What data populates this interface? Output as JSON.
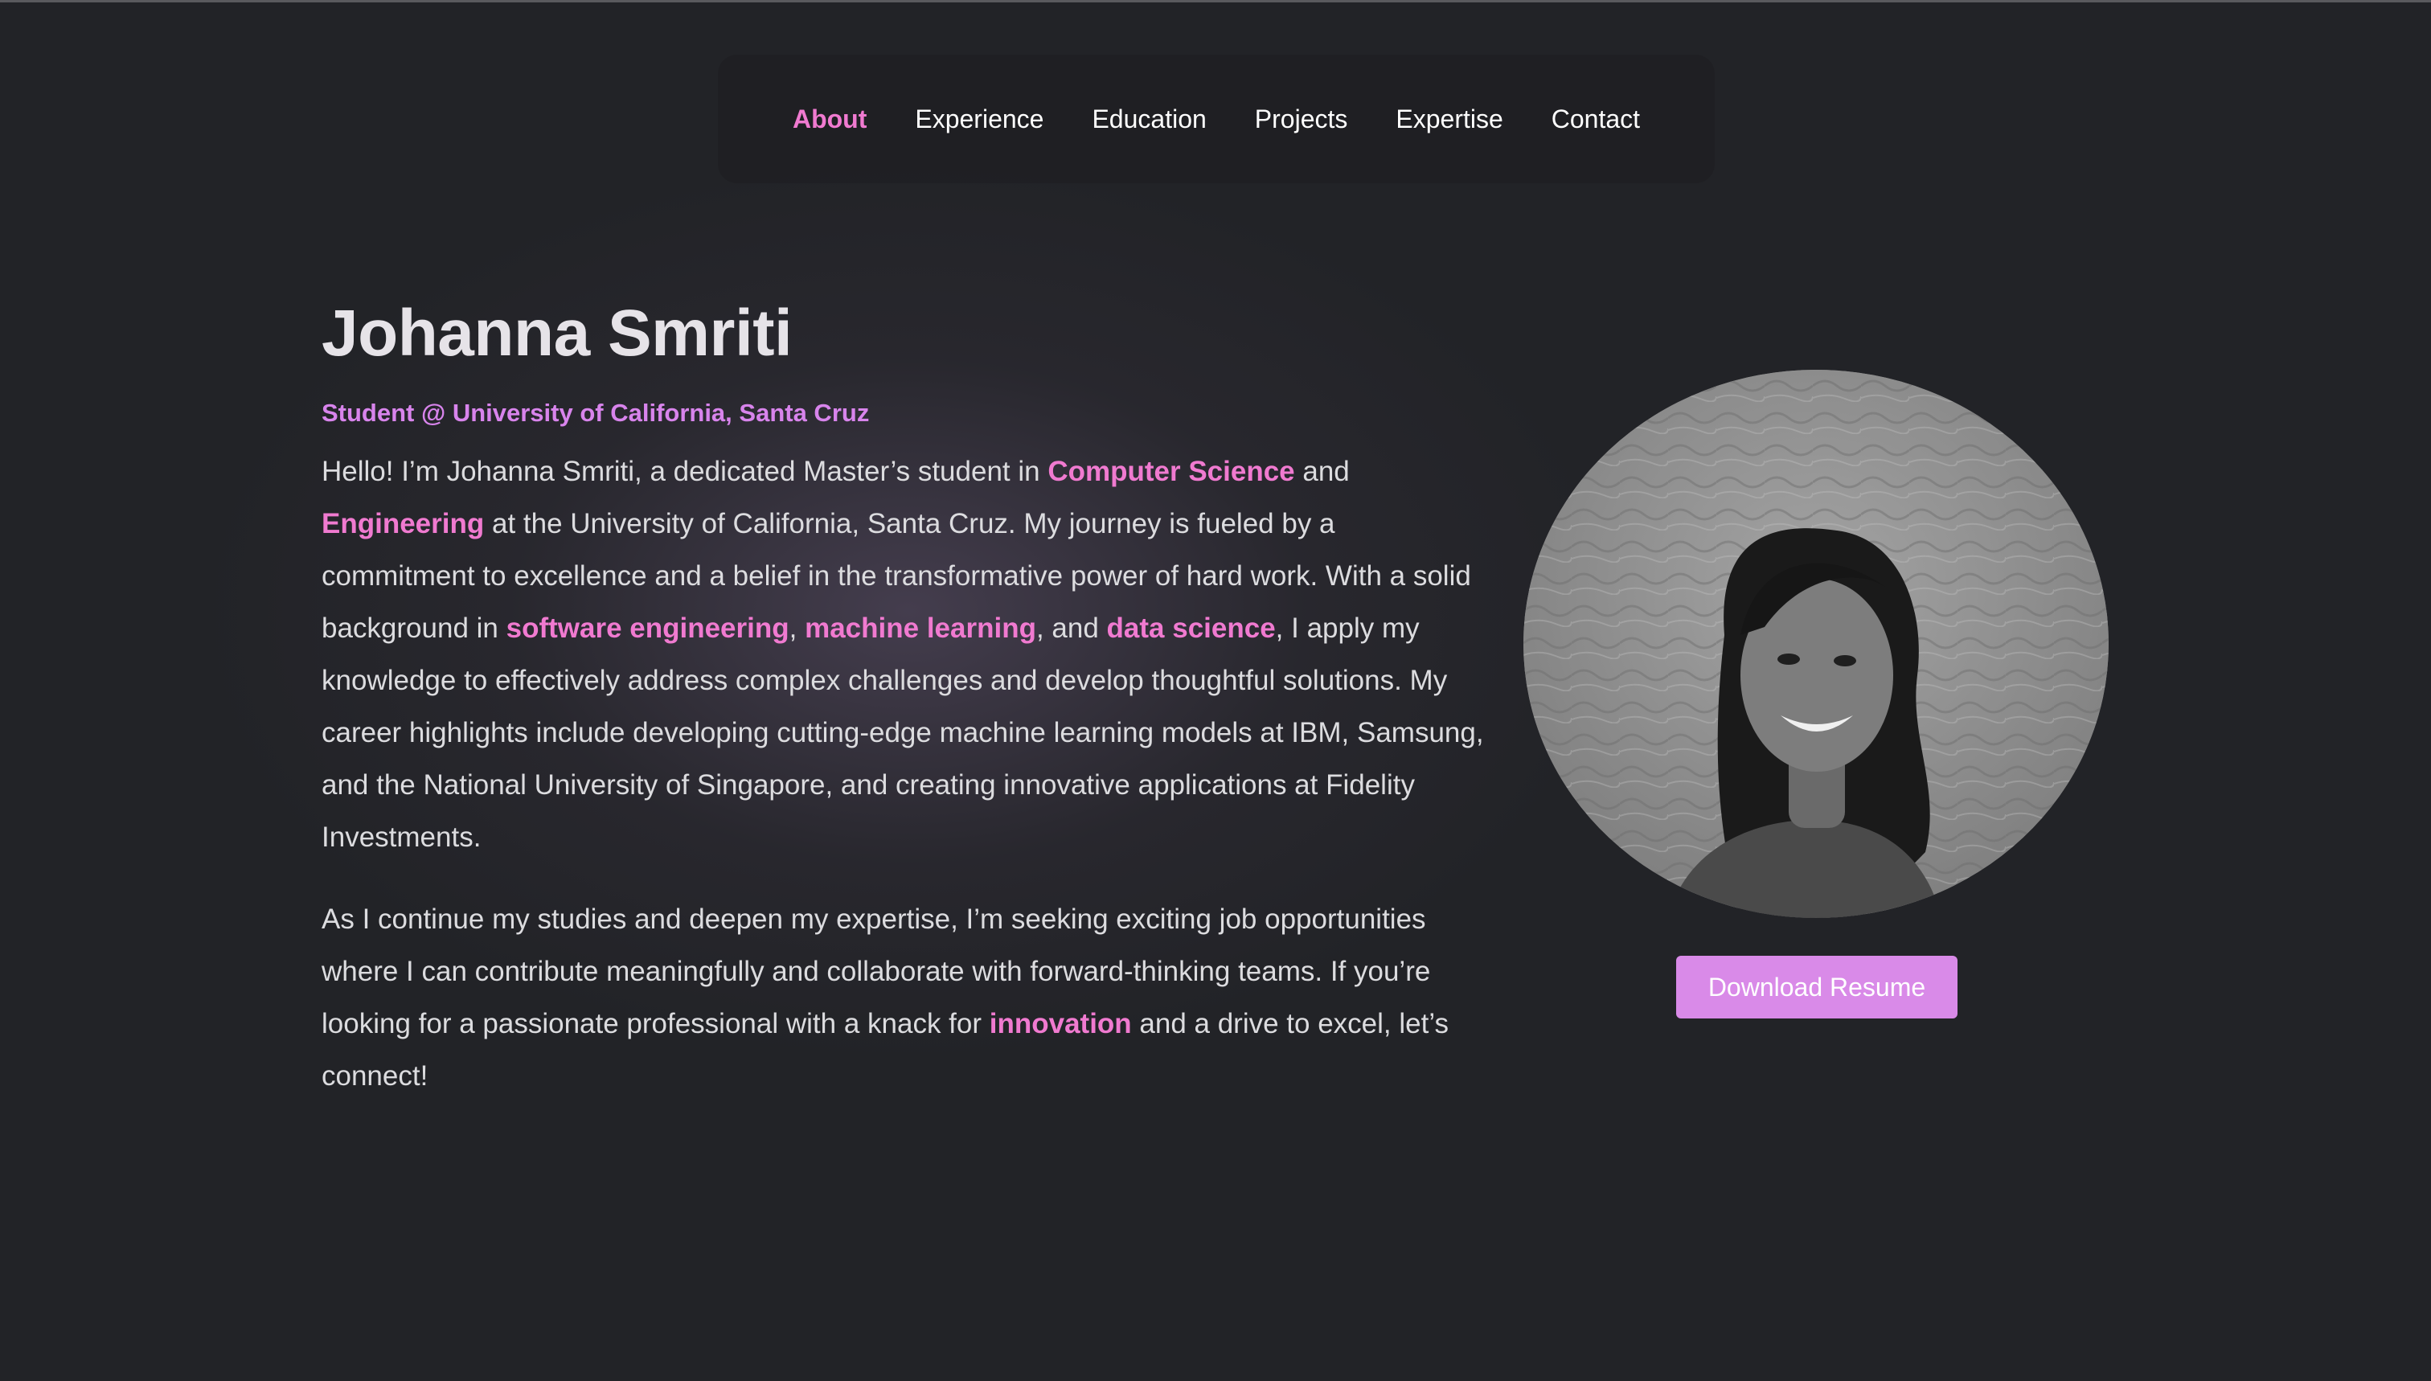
{
  "nav": {
    "items": [
      {
        "label": "About",
        "active": true
      },
      {
        "label": "Experience",
        "active": false
      },
      {
        "label": "Education",
        "active": false
      },
      {
        "label": "Projects",
        "active": false
      },
      {
        "label": "Expertise",
        "active": false
      },
      {
        "label": "Contact",
        "active": false
      }
    ]
  },
  "hero": {
    "name": "Johanna Smriti",
    "subtitle": "Student @ University of California, Santa Cruz",
    "paragraph1": {
      "t1": "Hello! I’m Johanna Smriti, a dedicated Master’s student in ",
      "h1": "Computer Science",
      "t2": " and ",
      "h2": "Engineering",
      "t3": " at the University of California, Santa Cruz. My journey is fueled by a commitment to excellence and a belief in the transformative power of hard work. With a solid background in ",
      "h3": "software engineering",
      "t4": ", ",
      "h4": "machine learning",
      "t5": ", and ",
      "h5": "data science",
      "t6": ", I apply my knowledge to effectively address complex challenges and develop thoughtful solutions. My career highlights include developing cutting-edge machine learning models at IBM, Samsung, and the National University of Singapore, and creating innovative applications at Fidelity Investments."
    },
    "paragraph2": {
      "t1": "As I continue my studies and deepen my expertise, I’m seeking exciting job opportunities where I can contribute meaningfully and collaborate with forward-thinking teams. If you’re looking for a passionate professional with a knack for ",
      "h1": "innovation",
      "t2": " and a drive to excel, let’s connect!"
    },
    "resume_button": "Download Resume"
  },
  "colors": {
    "background": "#222327",
    "accent_pink": "#f07ad0",
    "accent_purple": "#d884ec",
    "button": "#d98ae8"
  }
}
